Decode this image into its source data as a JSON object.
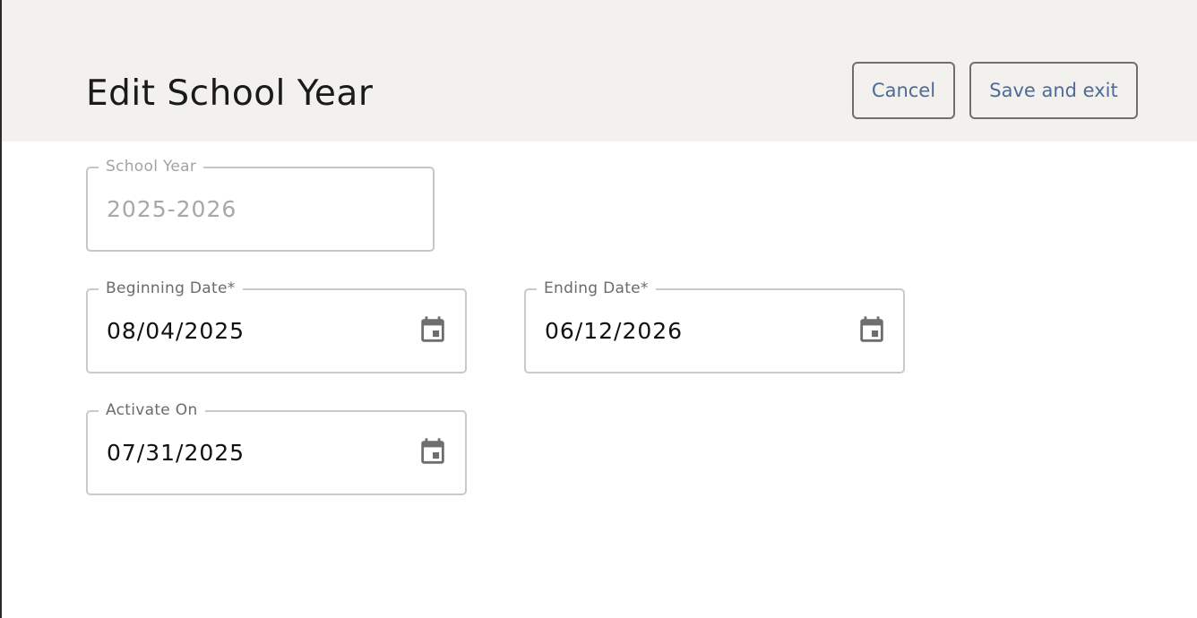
{
  "header": {
    "title": "Edit School Year",
    "cancel_label": "Cancel",
    "save_label": "Save and exit"
  },
  "form": {
    "school_year": {
      "label": "School Year",
      "value": "2025-2026",
      "disabled": true
    },
    "beginning_date": {
      "label": "Beginning Date*",
      "value": "08/04/2025",
      "icon": "calendar-icon"
    },
    "ending_date": {
      "label": "Ending Date*",
      "value": "06/12/2026",
      "icon": "calendar-icon"
    },
    "activate_on": {
      "label": "Activate On",
      "value": "07/31/2025",
      "icon": "calendar-icon"
    }
  },
  "colors": {
    "header_bg": "#f2f1ee",
    "button_text": "#4d6b9a",
    "icon": "#6e6e6e"
  }
}
